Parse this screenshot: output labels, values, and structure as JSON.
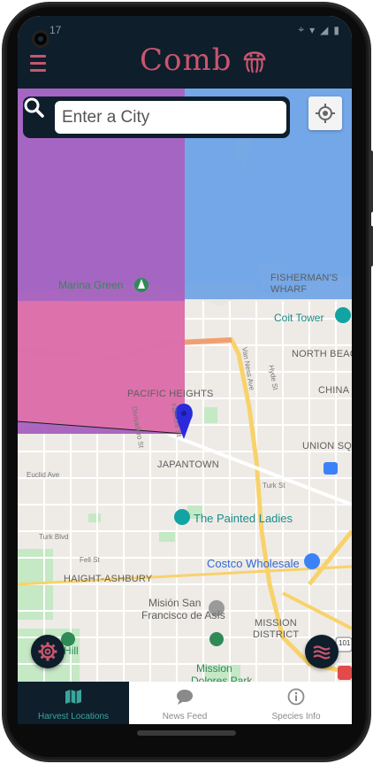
{
  "status": {
    "time": "17"
  },
  "header": {
    "title": "Comb",
    "menu_icon": "hamburger-menu-icon",
    "logo_icon": "jellyfish-icon",
    "accent": "#c9556f",
    "background": "#0e1e2b"
  },
  "search": {
    "placeholder": "Enter a City",
    "value": "",
    "search_icon": "search-icon",
    "locate_icon": "my-location-icon"
  },
  "map": {
    "overlay_colors": {
      "purple": "#a55bbd",
      "blue": "#6fa3e6",
      "pink": "#e573a8"
    },
    "pin_color": "#2a2adb",
    "labels": {
      "marina_green": "Marina Green",
      "fishermans_wharf": "FISHERMAN'S WHARF",
      "coit_tower": "Coit Tower",
      "north_beach": "NORTH BEAC",
      "chinatown": "CHINA",
      "pacific_heights": "PACIFIC HEIGHTS",
      "union_square": "UNION SQ",
      "japantown": "JAPANTOWN",
      "painted_ladies": "The Painted Ladies",
      "costco": "Costco Wholesale",
      "haight_ashbury": "HAIGHT-ASHBURY",
      "mision_line1": "Misión San",
      "mision_line2": "Francisco de Asís",
      "mission_district_1": "MISSION",
      "mission_district_2": "DISTRICT",
      "mission_dolores_1": "Mission",
      "mission_dolores_2": "Dolores Park",
      "hill": "Hill",
      "van_ness": "Van Ness Ave",
      "hyde": "Hyde St",
      "fillmore": "Fillmore St",
      "divisadero": "Divisadero St",
      "euclid": "Euclid Ave",
      "turk_w": "Turk Blvd",
      "turk_e": "Turk St",
      "fell": "Fell St",
      "route_101": "101"
    }
  },
  "fabs": {
    "settings_icon": "gear-icon",
    "layers_icon": "waves-icon"
  },
  "nav": {
    "tabs": [
      {
        "label": "Harvest Locations",
        "icon": "map-icon",
        "active": true
      },
      {
        "label": "News Feed",
        "icon": "chat-bubble-icon",
        "active": false
      },
      {
        "label": "Species Info",
        "icon": "info-icon",
        "active": false
      }
    ],
    "active_color": "#39a69c"
  }
}
